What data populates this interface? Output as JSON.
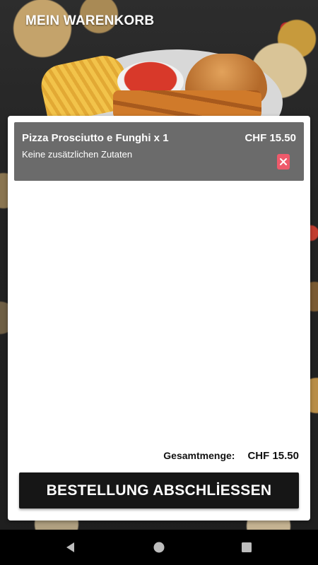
{
  "header": {
    "title": "MEIN WARENKORB"
  },
  "cart": {
    "items": [
      {
        "name": "Pizza Prosciutto e Funghi x 1",
        "price": "CHF 15.50",
        "extras": "Keine zusätzlichen Zutaten",
        "remove_icon": "close-icon"
      }
    ],
    "total_label": "Gesamtmenge:",
    "total_amount": "CHF 15.50",
    "checkout_label": "BESTELLUNG ABSCHLİESSEN"
  },
  "navigation": {
    "buttons": [
      "back-icon",
      "home-icon",
      "recent-apps-icon"
    ]
  },
  "colors": {
    "panel_bg": "#ffffff",
    "item_bg": "#6b6b6b",
    "remove_accent": "#ee5a6b",
    "button_bg": "#161616",
    "nav_bg": "#000000"
  }
}
